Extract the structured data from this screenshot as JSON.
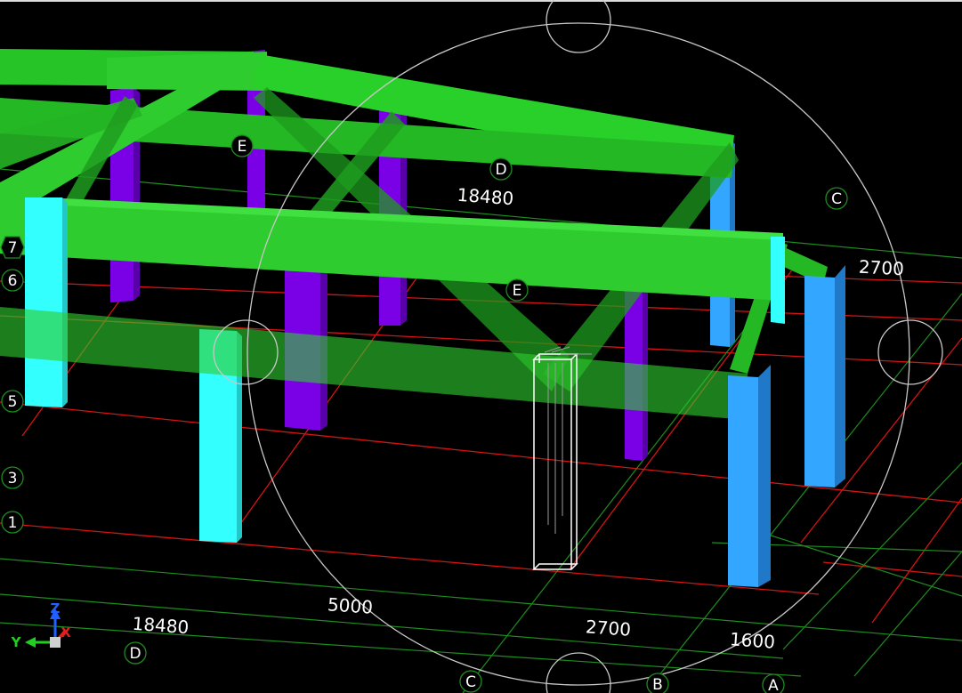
{
  "view": {
    "background": "#000000",
    "colors": {
      "beam": "#2ecc2e",
      "column_cyan": "#33ffff",
      "column_blue": "#33a6ff",
      "column_purple": "#8a00ff",
      "grid_red": "#e01010",
      "grid_green": "#1f8f1f",
      "gizmo": "#c8c8c8",
      "selected_wire": "#ffffff"
    }
  },
  "dimensions": {
    "top_span": "18480",
    "right_span": "2700",
    "bottom_left_span": "18480",
    "bottom_mid_span": "5000",
    "bottom_right_span_1": "2700",
    "bottom_right_span_2": "1600"
  },
  "grid_bubbles": {
    "left": [
      "7",
      "6",
      "5",
      "3",
      "1"
    ],
    "top": [
      "E",
      "D",
      "C",
      "E"
    ],
    "bottom": [
      "D",
      "C",
      "B",
      "A"
    ]
  },
  "axis_triad": {
    "x": "X",
    "y": "Y",
    "z": "Z"
  }
}
